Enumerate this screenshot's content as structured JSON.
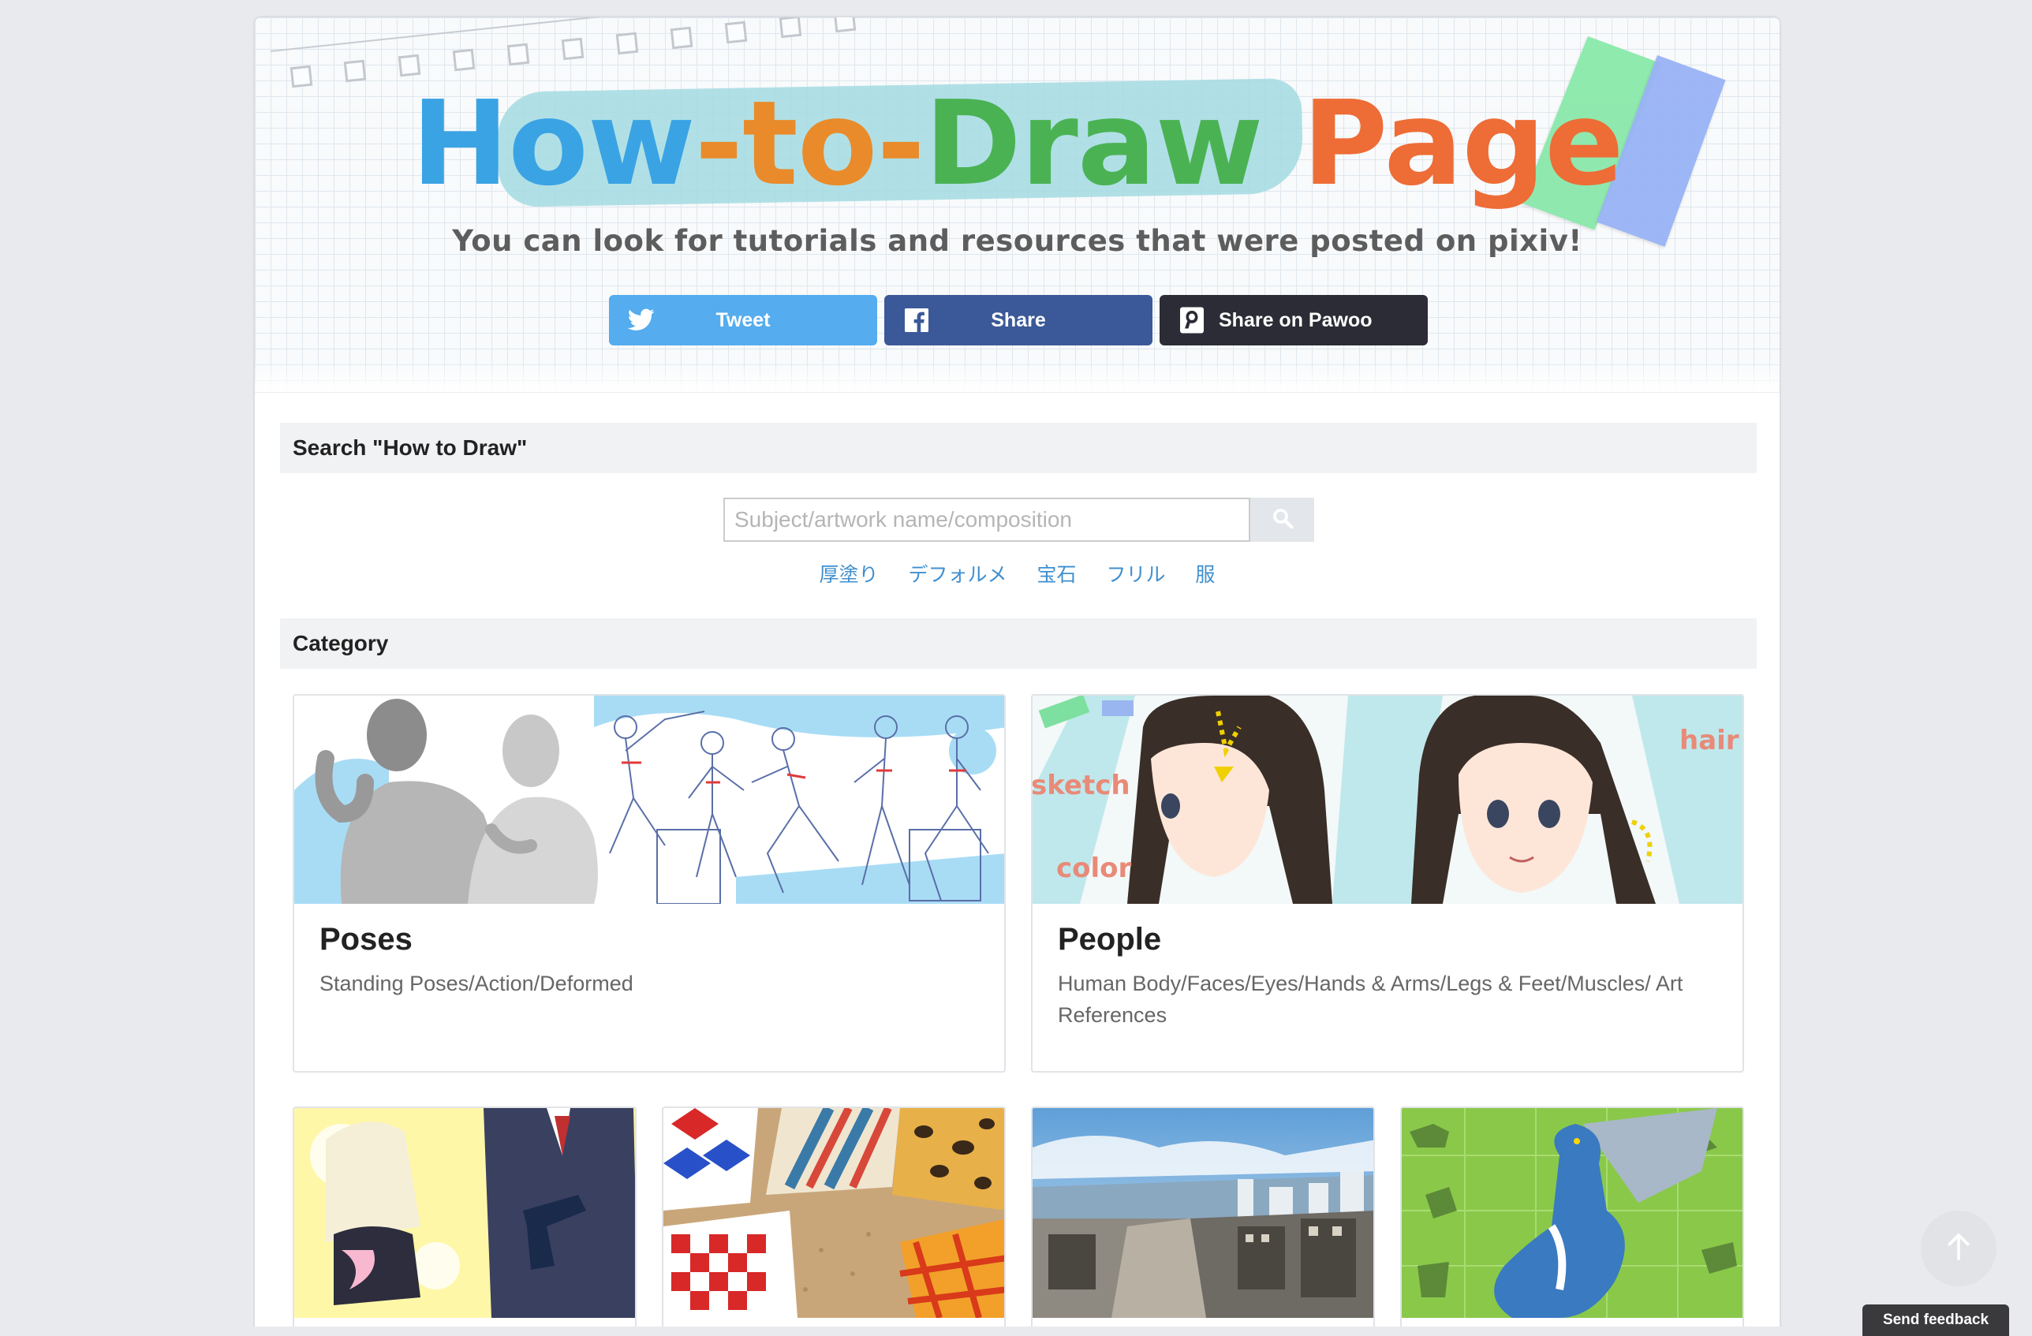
{
  "header": {
    "title_parts": [
      "How",
      "-",
      "to",
      "-",
      "Draw",
      " ",
      "Page"
    ],
    "subtitle": "You can look for tutorials and resources that were posted on pixiv!"
  },
  "share": {
    "tweet_label": "Tweet",
    "facebook_label": "Share",
    "pawoo_label": "Share on Pawoo"
  },
  "search": {
    "heading": "Search \"How to Draw\"",
    "placeholder": "Subject/artwork name/composition",
    "tags": [
      "厚塗り",
      "デフォルメ",
      "宝石",
      "フリル",
      "服"
    ]
  },
  "category": {
    "heading": "Category",
    "cards": [
      {
        "title": "Poses",
        "description": "Standing Poses/Action/Deformed"
      },
      {
        "title": "People",
        "description": "Human Body/Faces/Eyes/Hands & Arms/Legs & Feet/Muscles/ Art References",
        "image_labels": [
          "sketch",
          "color",
          "hair"
        ]
      }
    ]
  },
  "feedback_label": "Send feedback",
  "colors": {
    "twitter": "#55acee",
    "facebook": "#3b5998",
    "pawoo": "#2b2c35",
    "tag_link": "#3f8fcf",
    "title_blue": "#3aa3e4",
    "title_orange": "#e98b2b",
    "title_green": "#4bb254",
    "title_red": "#ee6c36"
  }
}
